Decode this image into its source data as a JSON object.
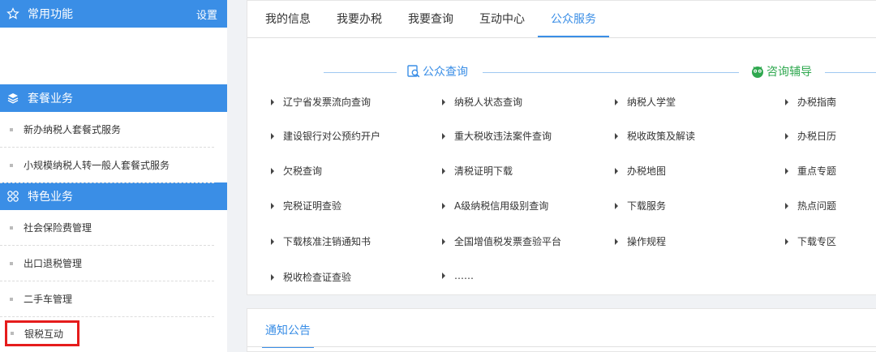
{
  "sidebar": {
    "common": {
      "title": "常用功能",
      "setting": "设置"
    },
    "package": {
      "title": "套餐业务",
      "items": [
        "新办纳税人套餐式服务",
        "小规模纳税人转一般人套餐式服务"
      ]
    },
    "special": {
      "title": "特色业务",
      "items": [
        "社会保险费管理",
        "出口退税管理",
        "二手车管理",
        "银税互动"
      ]
    }
  },
  "tabs": [
    "我的信息",
    "我要办税",
    "我要查询",
    "互动中心",
    "公众服务"
  ],
  "active_tab": "公众服务",
  "public_query": {
    "title": "公众查询",
    "col1": [
      "辽宁省发票流向查询",
      "建设银行对公预约开户",
      "欠税查询",
      "完税证明查验",
      "下载核准注销通知书",
      "税收检查证查验"
    ],
    "col2": [
      "纳税人状态查询",
      "重大税收违法案件查询",
      "清税证明下载",
      "A级纳税信用级别查询",
      "全国增值税发票查验平台",
      "……"
    ]
  },
  "consult": {
    "title": "咨询辅导",
    "col3": [
      "纳税人学堂",
      "税收政策及解读",
      "办税地图",
      "下载服务",
      "操作规程"
    ],
    "col4": [
      "办税指南",
      "办税日历",
      "重点专题",
      "热点问题",
      "下载专区"
    ]
  },
  "notice": {
    "title": "通知公告"
  },
  "colors": {
    "accent": "#3a8ee6",
    "green": "#2fa84f",
    "highlight": "#e51c1c"
  }
}
